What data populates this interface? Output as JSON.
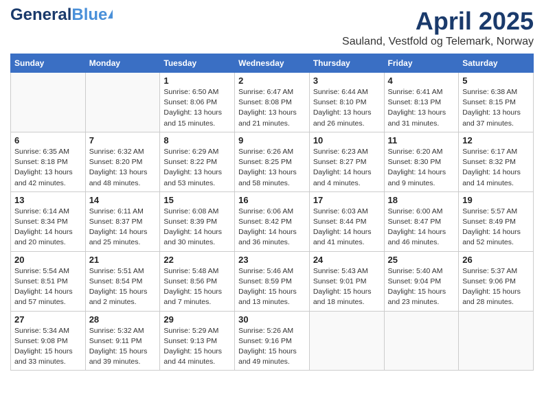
{
  "logo": {
    "general": "General",
    "blue": "Blue",
    "triangle": "▲"
  },
  "title": {
    "month": "April 2025",
    "location": "Sauland, Vestfold og Telemark, Norway"
  },
  "headers": [
    "Sunday",
    "Monday",
    "Tuesday",
    "Wednesday",
    "Thursday",
    "Friday",
    "Saturday"
  ],
  "weeks": [
    [
      {
        "day": "",
        "info": ""
      },
      {
        "day": "",
        "info": ""
      },
      {
        "day": "1",
        "info": "Sunrise: 6:50 AM\nSunset: 8:06 PM\nDaylight: 13 hours and 15 minutes."
      },
      {
        "day": "2",
        "info": "Sunrise: 6:47 AM\nSunset: 8:08 PM\nDaylight: 13 hours and 21 minutes."
      },
      {
        "day": "3",
        "info": "Sunrise: 6:44 AM\nSunset: 8:10 PM\nDaylight: 13 hours and 26 minutes."
      },
      {
        "day": "4",
        "info": "Sunrise: 6:41 AM\nSunset: 8:13 PM\nDaylight: 13 hours and 31 minutes."
      },
      {
        "day": "5",
        "info": "Sunrise: 6:38 AM\nSunset: 8:15 PM\nDaylight: 13 hours and 37 minutes."
      }
    ],
    [
      {
        "day": "6",
        "info": "Sunrise: 6:35 AM\nSunset: 8:18 PM\nDaylight: 13 hours and 42 minutes."
      },
      {
        "day": "7",
        "info": "Sunrise: 6:32 AM\nSunset: 8:20 PM\nDaylight: 13 hours and 48 minutes."
      },
      {
        "day": "8",
        "info": "Sunrise: 6:29 AM\nSunset: 8:22 PM\nDaylight: 13 hours and 53 minutes."
      },
      {
        "day": "9",
        "info": "Sunrise: 6:26 AM\nSunset: 8:25 PM\nDaylight: 13 hours and 58 minutes."
      },
      {
        "day": "10",
        "info": "Sunrise: 6:23 AM\nSunset: 8:27 PM\nDaylight: 14 hours and 4 minutes."
      },
      {
        "day": "11",
        "info": "Sunrise: 6:20 AM\nSunset: 8:30 PM\nDaylight: 14 hours and 9 minutes."
      },
      {
        "day": "12",
        "info": "Sunrise: 6:17 AM\nSunset: 8:32 PM\nDaylight: 14 hours and 14 minutes."
      }
    ],
    [
      {
        "day": "13",
        "info": "Sunrise: 6:14 AM\nSunset: 8:34 PM\nDaylight: 14 hours and 20 minutes."
      },
      {
        "day": "14",
        "info": "Sunrise: 6:11 AM\nSunset: 8:37 PM\nDaylight: 14 hours and 25 minutes."
      },
      {
        "day": "15",
        "info": "Sunrise: 6:08 AM\nSunset: 8:39 PM\nDaylight: 14 hours and 30 minutes."
      },
      {
        "day": "16",
        "info": "Sunrise: 6:06 AM\nSunset: 8:42 PM\nDaylight: 14 hours and 36 minutes."
      },
      {
        "day": "17",
        "info": "Sunrise: 6:03 AM\nSunset: 8:44 PM\nDaylight: 14 hours and 41 minutes."
      },
      {
        "day": "18",
        "info": "Sunrise: 6:00 AM\nSunset: 8:47 PM\nDaylight: 14 hours and 46 minutes."
      },
      {
        "day": "19",
        "info": "Sunrise: 5:57 AM\nSunset: 8:49 PM\nDaylight: 14 hours and 52 minutes."
      }
    ],
    [
      {
        "day": "20",
        "info": "Sunrise: 5:54 AM\nSunset: 8:51 PM\nDaylight: 14 hours and 57 minutes."
      },
      {
        "day": "21",
        "info": "Sunrise: 5:51 AM\nSunset: 8:54 PM\nDaylight: 15 hours and 2 minutes."
      },
      {
        "day": "22",
        "info": "Sunrise: 5:48 AM\nSunset: 8:56 PM\nDaylight: 15 hours and 7 minutes."
      },
      {
        "day": "23",
        "info": "Sunrise: 5:46 AM\nSunset: 8:59 PM\nDaylight: 15 hours and 13 minutes."
      },
      {
        "day": "24",
        "info": "Sunrise: 5:43 AM\nSunset: 9:01 PM\nDaylight: 15 hours and 18 minutes."
      },
      {
        "day": "25",
        "info": "Sunrise: 5:40 AM\nSunset: 9:04 PM\nDaylight: 15 hours and 23 minutes."
      },
      {
        "day": "26",
        "info": "Sunrise: 5:37 AM\nSunset: 9:06 PM\nDaylight: 15 hours and 28 minutes."
      }
    ],
    [
      {
        "day": "27",
        "info": "Sunrise: 5:34 AM\nSunset: 9:08 PM\nDaylight: 15 hours and 33 minutes."
      },
      {
        "day": "28",
        "info": "Sunrise: 5:32 AM\nSunset: 9:11 PM\nDaylight: 15 hours and 39 minutes."
      },
      {
        "day": "29",
        "info": "Sunrise: 5:29 AM\nSunset: 9:13 PM\nDaylight: 15 hours and 44 minutes."
      },
      {
        "day": "30",
        "info": "Sunrise: 5:26 AM\nSunset: 9:16 PM\nDaylight: 15 hours and 49 minutes."
      },
      {
        "day": "",
        "info": ""
      },
      {
        "day": "",
        "info": ""
      },
      {
        "day": "",
        "info": ""
      }
    ]
  ]
}
